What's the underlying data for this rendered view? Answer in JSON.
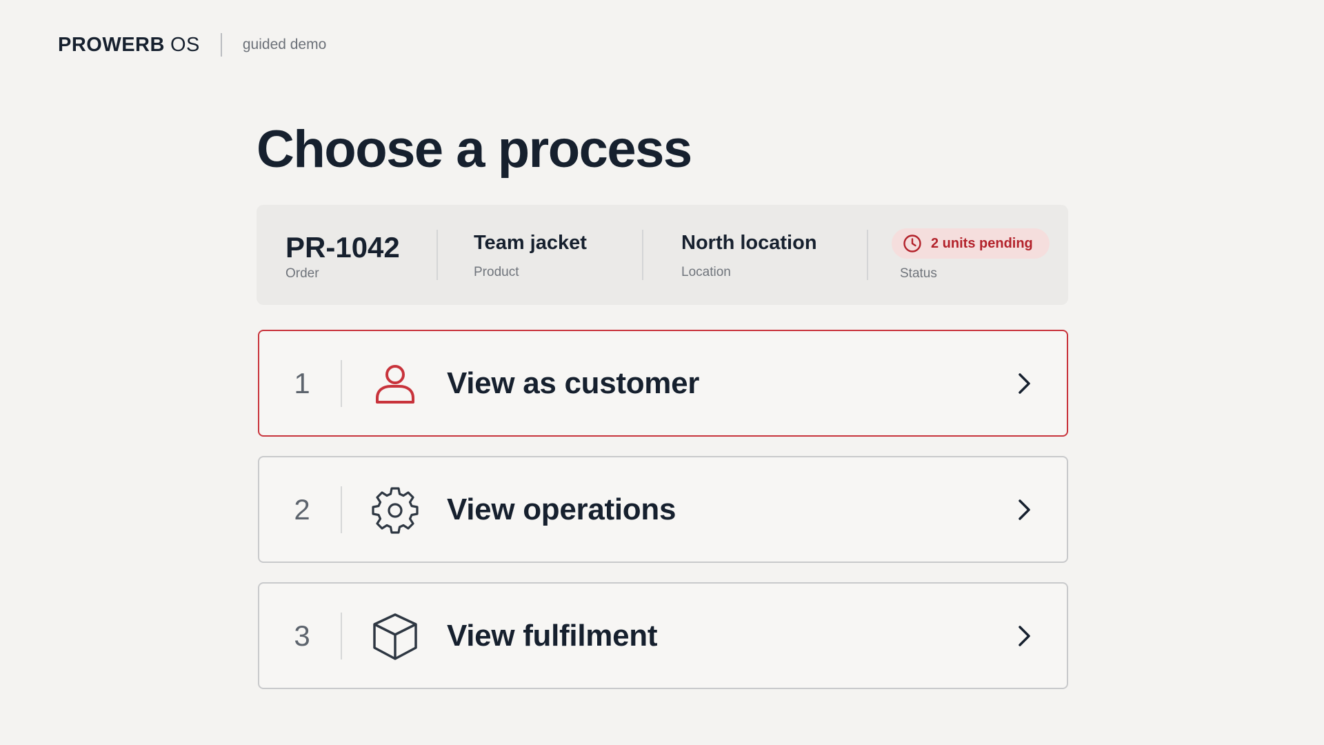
{
  "header": {
    "brand_strong": "PROWERB",
    "brand_light": "OS",
    "subtitle": "guided demo"
  },
  "title": "Choose a process",
  "summary": {
    "order": {
      "value": "PR-1042",
      "label": "Order"
    },
    "product": {
      "value": "Team jacket",
      "label": "Product"
    },
    "location": {
      "value": "North location",
      "label": "Location"
    },
    "status": {
      "value": "2 units pending",
      "label": "Status",
      "icon": "clock-icon"
    }
  },
  "processes": [
    {
      "number": "1",
      "label": "View as customer",
      "icon": "user-icon",
      "active": true
    },
    {
      "number": "2",
      "label": "View operations",
      "icon": "gear-icon",
      "active": false
    },
    {
      "number": "3",
      "label": "View fulfilment",
      "icon": "box-icon",
      "active": false
    }
  ],
  "colors": {
    "accent": "#c8333b",
    "text": "#16202e",
    "background": "#f4f3f1",
    "status_bg": "#f5dedd"
  }
}
